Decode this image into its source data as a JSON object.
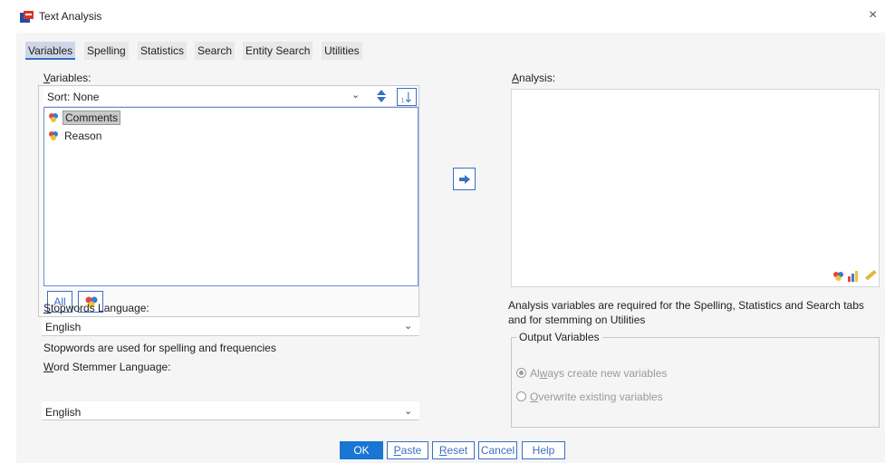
{
  "window": {
    "title": "Text Analysis",
    "close_glyph": "×"
  },
  "tabs": [
    {
      "label": "Variables",
      "active": true
    },
    {
      "label": "Spelling"
    },
    {
      "label": "Statistics"
    },
    {
      "label": "Search"
    },
    {
      "label": "Entity Search"
    },
    {
      "label": "Utilities"
    }
  ],
  "variables": {
    "heading_mnemonic": "V",
    "heading_rest": "ariables:",
    "sort_label": "Sort:  None",
    "sort_chevron": "⌄",
    "items": [
      {
        "label": "Comments",
        "selected": true
      },
      {
        "label": "Reason",
        "selected": false
      }
    ],
    "all_button": "All"
  },
  "stopwords": {
    "heading_mnemonic": "S",
    "heading_rest": "topwords Language:",
    "value": "English",
    "note": "Stopwords are used for spelling and frequencies"
  },
  "stemmer": {
    "heading_mnemonic": "W",
    "heading_rest": "ord Stemmer Language:",
    "value": "English"
  },
  "analysis": {
    "heading_mnemonic": "A",
    "heading_rest": "nalysis:",
    "note_line1": "Analysis variables are required for the Spelling, Statistics and Search tabs",
    "note_line2": "and for stemming on Utilities"
  },
  "output_variables": {
    "legend": "Output Variables",
    "options": [
      {
        "pre": "Al",
        "mnemonic": "w",
        "post": "ays create new variables",
        "checked": true
      },
      {
        "pre": "",
        "mnemonic": "O",
        "post": "verwrite existing variables",
        "checked": false
      }
    ]
  },
  "buttons": {
    "ok": "OK",
    "paste_mnemonic": "P",
    "paste_rest": "aste",
    "reset_mnemonic": "R",
    "reset_rest": "eset",
    "cancel": "Cancel",
    "help": "Help"
  },
  "colors": {
    "accent": "#3b6fc4",
    "ok_button": "#1976d2",
    "selection": "#c8c8c8"
  },
  "icons": {
    "app": "text-analysis-app-icon",
    "variable": "nominal-string-variable-icon",
    "move": "arrow-right-icon",
    "analysis_toolbar": [
      "variables-icon",
      "bar-chart-icon",
      "ruler-icon"
    ]
  }
}
